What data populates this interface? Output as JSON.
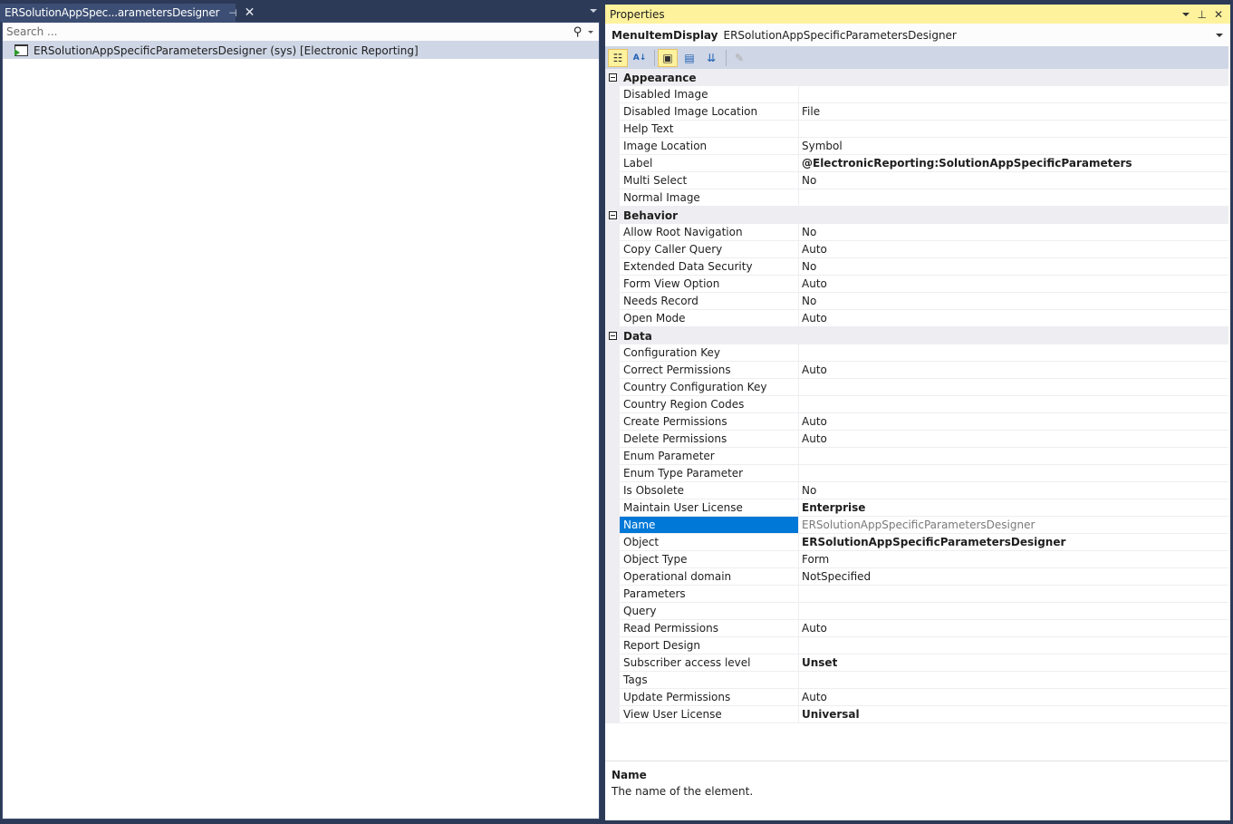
{
  "left": {
    "tab_title": "ERSolutionAppSpec...arametersDesigner",
    "pin_icon": "pin-icon",
    "close_icon": "close-icon",
    "search_placeholder": "Search ...",
    "tree_items": [
      {
        "label": "ERSolutionAppSpecificParametersDesigner (sys) [Electronic Reporting]",
        "icon": "menu-item-display-icon"
      }
    ]
  },
  "properties": {
    "title": "Properties",
    "object_type": "MenuItemDisplay",
    "object_name": "ERSolutionAppSpecificParametersDesigner",
    "toolbar": [
      {
        "name": "categorized",
        "symbol": "☷",
        "active": true
      },
      {
        "name": "alphabetical",
        "symbol": "A↓",
        "active": false
      },
      {
        "name": "properties",
        "symbol": "🔧",
        "active": true
      },
      {
        "name": "events",
        "symbol": "⚡",
        "active": false
      },
      {
        "name": "sort-order",
        "symbol": "⇅",
        "active": false
      },
      {
        "name": "property-pages",
        "symbol": "🔑",
        "active": false,
        "disabled": true
      }
    ],
    "categories": [
      {
        "name": "Appearance",
        "rows": [
          {
            "name": "Disabled Image",
            "value": ""
          },
          {
            "name": "Disabled Image Location",
            "value": "File"
          },
          {
            "name": "Help Text",
            "value": ""
          },
          {
            "name": "Image Location",
            "value": "Symbol"
          },
          {
            "name": "Label",
            "value": "@ElectronicReporting:SolutionAppSpecificParameters",
            "bold": true
          },
          {
            "name": "Multi Select",
            "value": "No"
          },
          {
            "name": "Normal Image",
            "value": ""
          }
        ]
      },
      {
        "name": "Behavior",
        "rows": [
          {
            "name": "Allow Root Navigation",
            "value": "No"
          },
          {
            "name": "Copy Caller Query",
            "value": "Auto"
          },
          {
            "name": "Extended Data Security",
            "value": "No"
          },
          {
            "name": "Form View Option",
            "value": "Auto"
          },
          {
            "name": "Needs Record",
            "value": "No"
          },
          {
            "name": "Open Mode",
            "value": "Auto"
          }
        ]
      },
      {
        "name": "Data",
        "rows": [
          {
            "name": "Configuration Key",
            "value": ""
          },
          {
            "name": "Correct Permissions",
            "value": "Auto"
          },
          {
            "name": "Country Configuration Key",
            "value": ""
          },
          {
            "name": "Country Region Codes",
            "value": ""
          },
          {
            "name": "Create Permissions",
            "value": "Auto"
          },
          {
            "name": "Delete Permissions",
            "value": "Auto"
          },
          {
            "name": "Enum Parameter",
            "value": ""
          },
          {
            "name": "Enum Type Parameter",
            "value": ""
          },
          {
            "name": "Is Obsolete",
            "value": "No"
          },
          {
            "name": "Maintain User License",
            "value": "Enterprise",
            "bold": true
          },
          {
            "name": "Name",
            "value": "ERSolutionAppSpecificParametersDesigner",
            "selected": true,
            "readonly": true
          },
          {
            "name": "Object",
            "value": "ERSolutionAppSpecificParametersDesigner",
            "bold": true
          },
          {
            "name": "Object Type",
            "value": "Form"
          },
          {
            "name": "Operational domain",
            "value": "NotSpecified"
          },
          {
            "name": "Parameters",
            "value": ""
          },
          {
            "name": "Query",
            "value": ""
          },
          {
            "name": "Read Permissions",
            "value": "Auto"
          },
          {
            "name": "Report Design",
            "value": ""
          },
          {
            "name": "Subscriber access level",
            "value": "Unset",
            "bold": true
          },
          {
            "name": "Tags",
            "value": ""
          },
          {
            "name": "Update Permissions",
            "value": "Auto"
          },
          {
            "name": "View User License",
            "value": "Universal",
            "bold": true
          }
        ]
      }
    ],
    "description": {
      "title": "Name",
      "text": "The name of the element."
    }
  }
}
